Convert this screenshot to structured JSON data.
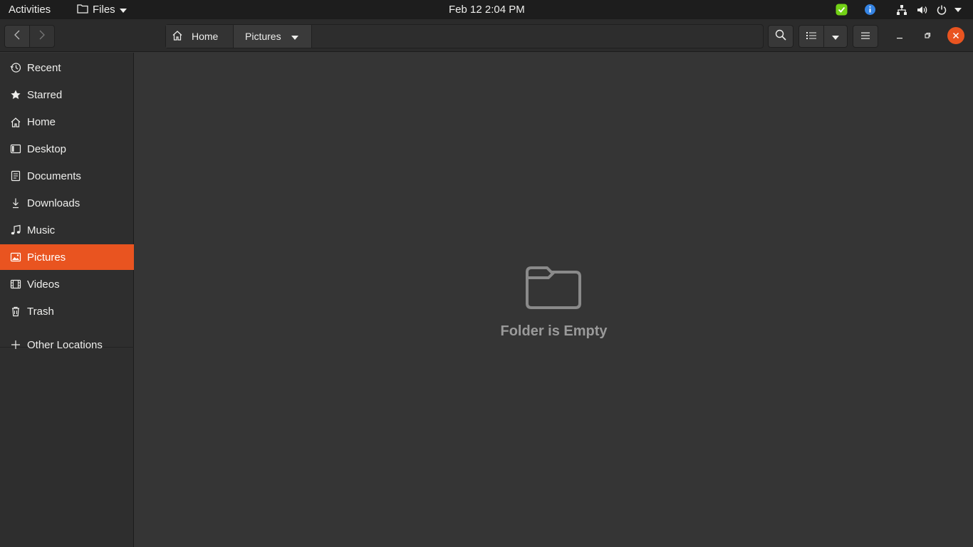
{
  "topbar": {
    "activities": "Activities",
    "app_name": "Files",
    "clock": "Feb 12  2:04 PM",
    "colors": {
      "bg": "#1d1d1d",
      "shield": "#73d216",
      "info": "#3584e4"
    }
  },
  "toolbar": {
    "path": [
      "Home",
      "Pictures"
    ]
  },
  "sidebar": {
    "items": [
      {
        "label": "Recent",
        "icon": "clock-icon"
      },
      {
        "label": "Starred",
        "icon": "star-icon"
      },
      {
        "label": "Home",
        "icon": "home-icon"
      },
      {
        "label": "Desktop",
        "icon": "desktop-icon"
      },
      {
        "label": "Documents",
        "icon": "document-icon"
      },
      {
        "label": "Downloads",
        "icon": "download-icon"
      },
      {
        "label": "Music",
        "icon": "music-icon"
      },
      {
        "label": "Pictures",
        "icon": "picture-icon",
        "active": true
      },
      {
        "label": "Videos",
        "icon": "video-icon"
      },
      {
        "label": "Trash",
        "icon": "trash-icon"
      }
    ],
    "other_locations": "Other Locations",
    "colors": {
      "accent": "#e95420"
    }
  },
  "main": {
    "empty_text": "Folder is Empty"
  }
}
